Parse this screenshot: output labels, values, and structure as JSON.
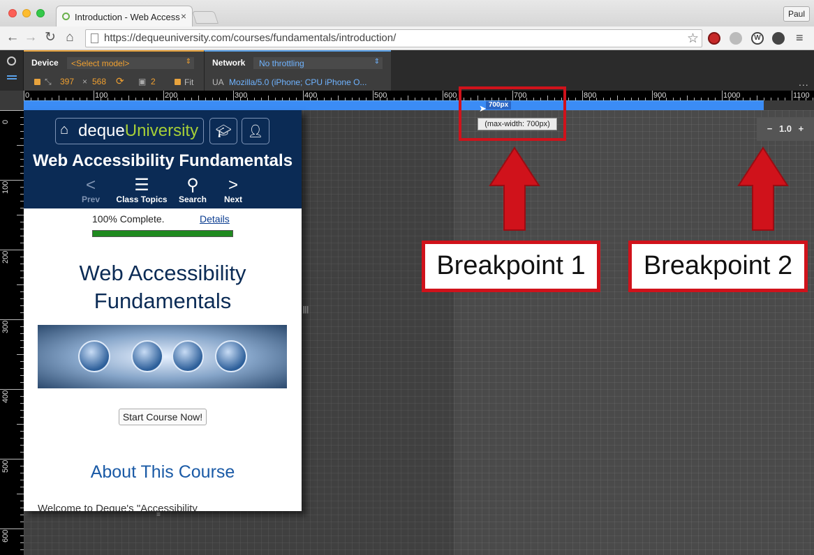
{
  "browser": {
    "tab_title": "Introduction - Web Access",
    "tab_close": "×",
    "profile": "Paul",
    "url": "https://dequeuniversity.com/courses/fundamentals/introduction/"
  },
  "devtools": {
    "device_label": "Device",
    "device_select": "<Select model>",
    "width": "397",
    "times": "×",
    "height": "568",
    "dpr": "2",
    "fit_label": "Fit",
    "network_label": "Network",
    "network_select": "No throttling",
    "ua_label": "UA",
    "ua_value": "Mozilla/5.0 (iPhone; CPU iPhone O...",
    "more": "...",
    "ruler_ticks": [
      "0",
      "100",
      "200",
      "300",
      "400",
      "500",
      "600",
      "700",
      "800",
      "900",
      "1000",
      "1100"
    ],
    "vruler_ticks": [
      "0",
      "100",
      "200",
      "300",
      "400",
      "500",
      "600"
    ],
    "mq_label": "700px",
    "mq_tooltip": "(max-width: 700px)",
    "zoom_minus": "−",
    "zoom_value": "1.0",
    "zoom_plus": "+"
  },
  "site": {
    "logo_deque": "deque",
    "logo_university": "University",
    "title": "Web Accessibility Fundamentals",
    "nav": [
      {
        "label": "Prev",
        "icon": "<"
      },
      {
        "label": "Class Topics",
        "icon": "☰"
      },
      {
        "label": "Search",
        "icon": "⚲"
      },
      {
        "label": "Next",
        "icon": ">"
      }
    ],
    "progress_text": "100% Complete.",
    "progress_value": 1.0,
    "details_link": "Details",
    "heading_line1": "Web Accessibility",
    "heading_line2": "Fundamentals",
    "start_button": "Start Course Now!",
    "about_heading": "About This Course",
    "welcome_text": "Welcome to Deque's \"Accessibility"
  },
  "annotations": {
    "breakpoint1": "Breakpoint 1",
    "breakpoint2": "Breakpoint 2",
    "color": "#d0121b"
  }
}
